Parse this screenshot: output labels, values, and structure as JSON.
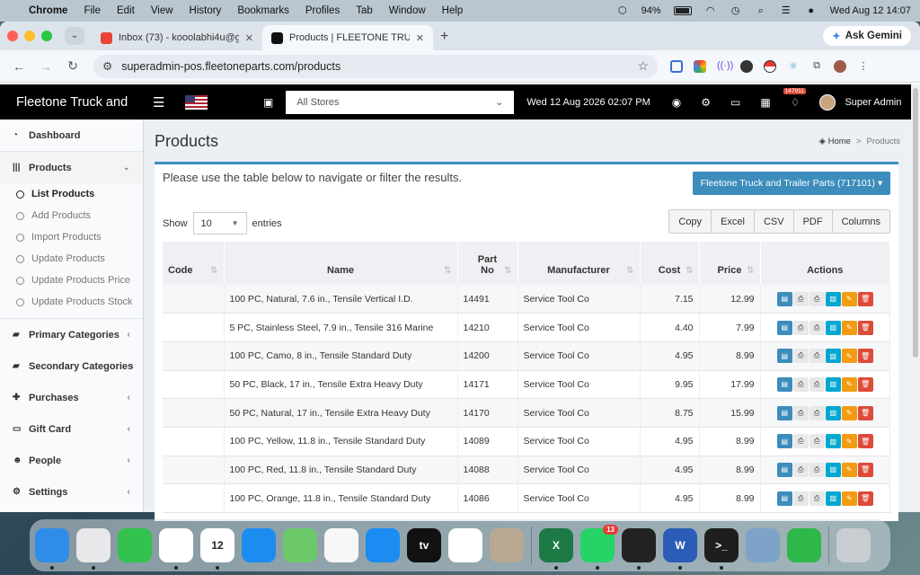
{
  "menubar": {
    "app": "Chrome",
    "items": [
      "File",
      "Edit",
      "View",
      "History",
      "Bookmarks",
      "Profiles",
      "Tab",
      "Window",
      "Help"
    ],
    "battery": "94%",
    "clock": "Wed Aug 12  14:07"
  },
  "browser": {
    "tabs": [
      {
        "title": "Inbox (73) - kooolabhi4u@gm",
        "favicon_color": "#ea4335"
      },
      {
        "title": "Products | FLEETONE  TRUCK",
        "favicon_color": "#111111"
      }
    ],
    "new_tab": "+",
    "gemini_label": "Ask Gemini",
    "url": "superadmin-pos.fleetoneparts.com/products"
  },
  "app": {
    "brand": "Fleetone Truck and",
    "store_select": "All Stores",
    "datetime": "Wed 12 Aug 2026 02:07 PM",
    "notification_count": "147911",
    "user_name": "Super Admin"
  },
  "sidebar": {
    "items": [
      {
        "label": "Dashboard",
        "icon": "dashboard-icon"
      },
      {
        "label": "Products",
        "icon": "barcode-icon"
      },
      {
        "label": "Primary Categories",
        "icon": "folder-icon"
      },
      {
        "label": "Secondary Categories",
        "icon": "folder-icon"
      },
      {
        "label": "Purchases",
        "icon": "plus-icon"
      },
      {
        "label": "Gift Card",
        "icon": "credit-card-icon"
      },
      {
        "label": "People",
        "icon": "users-icon"
      },
      {
        "label": "Settings",
        "icon": "cogs-icon"
      }
    ],
    "product_sub": [
      "List Products",
      "Add Products",
      "Import Products",
      "Update Products",
      "Update Products Price",
      "Update Products Stock"
    ]
  },
  "page": {
    "title": "Products",
    "breadcrumb_home": "Home",
    "breadcrumb_current": "Products",
    "intro": "Please use the table below to navigate or filter the results.",
    "filter_button": "Fleetone Truck and Trailer Parts (717101)",
    "show_label": "Show",
    "entries_value": "10",
    "entries_label": "entries",
    "export_buttons": [
      "Copy",
      "Excel",
      "CSV",
      "PDF",
      "Columns"
    ]
  },
  "table": {
    "headers": {
      "code": "Code",
      "name": "Name",
      "part_no_1": "Part",
      "part_no_2": "No",
      "manufacturer": "Manufacturer",
      "cost": "Cost",
      "price": "Price",
      "actions": "Actions"
    },
    "rows": [
      {
        "code": "",
        "name": "100 PC, Natural, 7.6 in., Tensile Vertical I.D.",
        "part_no": "14491",
        "manufacturer": "Service Tool Co",
        "cost": "7.15",
        "price": "12.99"
      },
      {
        "code": "",
        "name": "5 PC, Stainless Steel, 7.9 in., Tensile 316 Marine",
        "part_no": "14210",
        "manufacturer": "Service Tool Co",
        "cost": "4.40",
        "price": "7.99"
      },
      {
        "code": "",
        "name": "100 PC, Camo, 8 in., Tensile Standard Duty",
        "part_no": "14200",
        "manufacturer": "Service Tool Co",
        "cost": "4.95",
        "price": "8.99"
      },
      {
        "code": "",
        "name": "50 PC, Black, 17 in., Tensile Extra Heavy Duty",
        "part_no": "14171",
        "manufacturer": "Service Tool Co",
        "cost": "9.95",
        "price": "17.99"
      },
      {
        "code": "",
        "name": "50 PC, Natural, 17 in., Tensile Extra Heavy Duty",
        "part_no": "14170",
        "manufacturer": "Service Tool Co",
        "cost": "8.75",
        "price": "15.99"
      },
      {
        "code": "",
        "name": "100 PC, Yellow, 11.8 in., Tensile Standard Duty",
        "part_no": "14089",
        "manufacturer": "Service Tool Co",
        "cost": "4.95",
        "price": "8.99"
      },
      {
        "code": "",
        "name": "100 PC, Red, 11.8 in., Tensile Standard Duty",
        "part_no": "14088",
        "manufacturer": "Service Tool Co",
        "cost": "4.95",
        "price": "8.99"
      },
      {
        "code": "",
        "name": "100 PC, Orange, 11.8 in., Tensile Standard Duty",
        "part_no": "14086",
        "manufacturer": "Service Tool Co",
        "cost": "4.95",
        "price": "8.99"
      }
    ]
  },
  "colors": {
    "accent": "#3c8dbc",
    "danger": "#dd4b39",
    "warning": "#f39c12",
    "info": "#00a7d0"
  },
  "dock": {
    "apps": [
      {
        "name": "finder",
        "color": "#2f8ce8",
        "label": ""
      },
      {
        "name": "launchpad",
        "color": "#e8e8ea",
        "label": ""
      },
      {
        "name": "facetime",
        "color": "#33c24d",
        "label": ""
      },
      {
        "name": "chrome",
        "color": "#ffffff",
        "label": ""
      },
      {
        "name": "calendar",
        "color": "#ffffff",
        "label": "12"
      },
      {
        "name": "keynote",
        "color": "#1c8cf0",
        "label": ""
      },
      {
        "name": "maps",
        "color": "#6cc96a",
        "label": ""
      },
      {
        "name": "photos",
        "color": "#f7f7f7",
        "label": ""
      },
      {
        "name": "app-store",
        "color": "#1a8cf2",
        "label": ""
      },
      {
        "name": "apple-tv",
        "color": "#111111",
        "label": "tv"
      },
      {
        "name": "reminders",
        "color": "#ffffff",
        "label": ""
      },
      {
        "name": "contacts",
        "color": "#b9a892",
        "label": ""
      },
      {
        "name": "excel",
        "color": "#1d7a45",
        "label": "X"
      },
      {
        "name": "whatsapp",
        "color": "#25d366",
        "label": "",
        "badge": "13"
      },
      {
        "name": "unity",
        "color": "#222222",
        "label": ""
      },
      {
        "name": "word",
        "color": "#2b5cb8",
        "label": "W"
      },
      {
        "name": "terminal",
        "color": "#1e1e1e",
        "label": ">_"
      },
      {
        "name": "automator",
        "color": "#7fa3c8",
        "label": ""
      },
      {
        "name": "numbers",
        "color": "#2fb84a",
        "label": ""
      },
      {
        "name": "trash",
        "color": "#c8cdd2",
        "label": ""
      }
    ]
  }
}
